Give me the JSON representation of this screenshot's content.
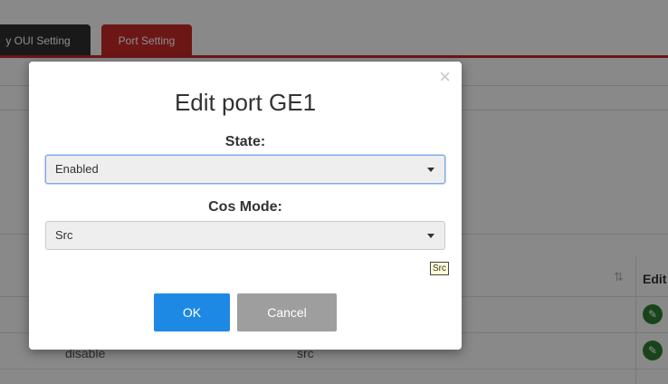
{
  "tabs": {
    "oui_setting": "y OUI Setting",
    "port_setting": "Port Setting"
  },
  "table": {
    "header_edit": "Edit",
    "sort_icon": "⇅",
    "rows": [
      {
        "state": "",
        "cos": ""
      },
      {
        "state": "disable",
        "cos": "src"
      }
    ]
  },
  "modal": {
    "title": "Edit port GE1",
    "close_icon": "×",
    "state_label": "State:",
    "state_value": "Enabled",
    "cos_label": "Cos Mode:",
    "cos_value": "Src",
    "tooltip": "Src",
    "ok_label": "OK",
    "cancel_label": "Cancel"
  },
  "colors": {
    "accent_red": "#c62828",
    "ok_blue": "#1e88e5",
    "edit_green": "#2e7d32"
  }
}
